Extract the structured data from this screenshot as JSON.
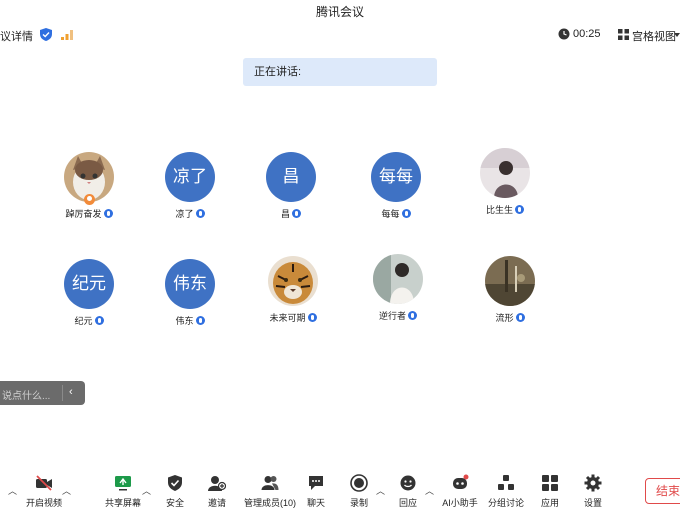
{
  "window": {
    "title": "腾讯会议"
  },
  "infobar": {
    "details_label": "议详情",
    "timer": "00:25",
    "view_label": "宫格视图"
  },
  "speaking": {
    "label": "正在讲话:"
  },
  "participants": [
    {
      "name": "踔厉奋发",
      "type": "image",
      "icon": "cat-photo",
      "host": true,
      "mic": "active"
    },
    {
      "name": "凉了",
      "type": "text",
      "avatar_text": "凉了",
      "mic": "muted"
    },
    {
      "name": "昌",
      "type": "text",
      "avatar_text": "昌",
      "mic": "muted"
    },
    {
      "name": "每每",
      "type": "text",
      "avatar_text": "每每",
      "mic": "muted"
    },
    {
      "name": "比生生",
      "type": "image",
      "icon": "person-photo",
      "mic": "muted"
    },
    {
      "name": "纪元",
      "type": "text",
      "avatar_text": "纪元",
      "mic": "muted"
    },
    {
      "name": "伟东",
      "type": "text",
      "avatar_text": "伟东",
      "mic": "muted"
    },
    {
      "name": "未来可期",
      "type": "image",
      "icon": "tiger-photo",
      "mic": "muted"
    },
    {
      "name": "逆行者",
      "type": "image",
      "icon": "person-photo",
      "mic": "muted"
    },
    {
      "name": "流形",
      "type": "image",
      "icon": "street-photo",
      "mic": "muted"
    }
  ],
  "chat": {
    "placeholder": "说点什么..."
  },
  "toolbar": {
    "video": "开启视频",
    "share": "共享屏幕",
    "security": "安全",
    "invite": "邀请",
    "members": "管理成员(10)",
    "chat": "聊天",
    "record": "录制",
    "react": "回应",
    "assistant": "AI小助手",
    "breakout": "分组讨论",
    "apps": "应用",
    "settings": "设置",
    "end": "结束会"
  },
  "colors": {
    "accent": "#3f72c4",
    "end": "#e04a4a",
    "speaking_bg": "#dde9fa"
  }
}
